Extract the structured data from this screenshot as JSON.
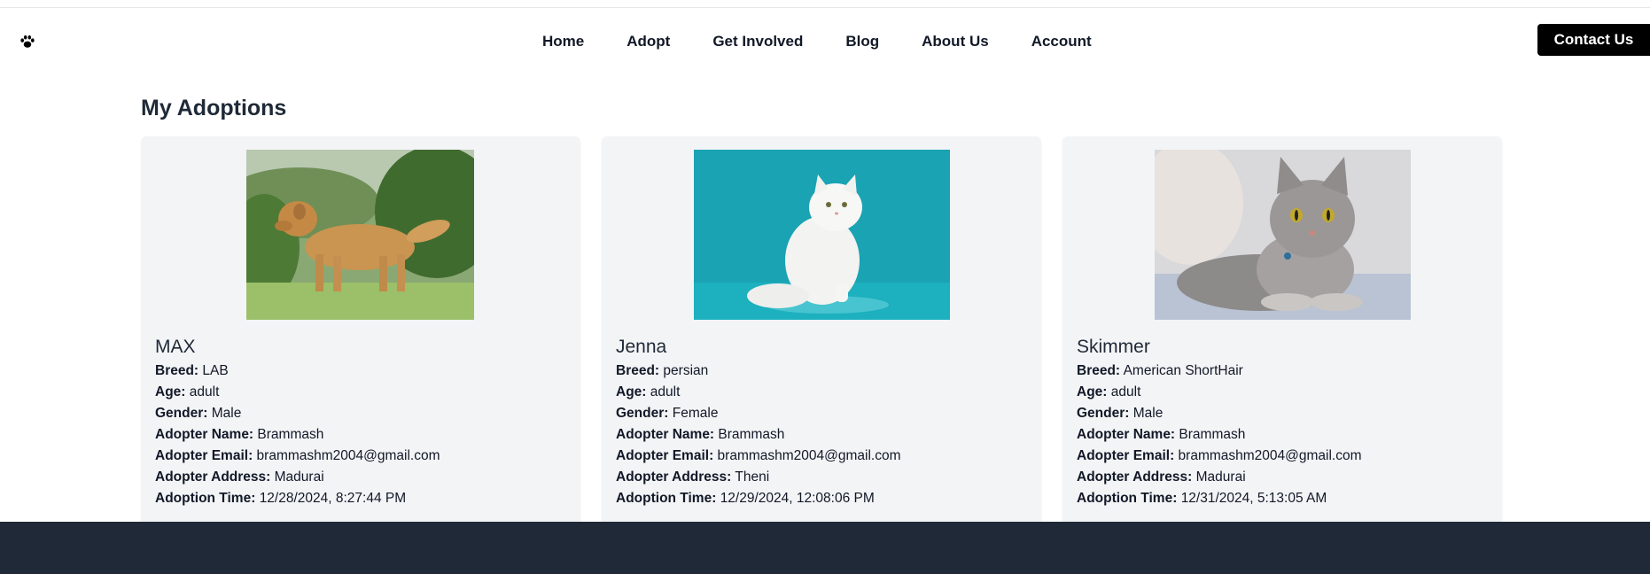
{
  "nav": {
    "logo_icon": "paw-icon",
    "links": [
      "Home",
      "Adopt",
      "Get Involved",
      "Blog",
      "About Us",
      "Account"
    ],
    "contact_label": "Contact Us"
  },
  "page": {
    "title": "My Adoptions"
  },
  "labels": {
    "breed": "Breed:",
    "age": "Age:",
    "gender": "Gender:",
    "adopter_name": "Adopter Name:",
    "adopter_email": "Adopter Email:",
    "adopter_address": "Adopter Address:",
    "adoption_time": "Adoption Time:"
  },
  "adoptions": [
    {
      "name": "MAX",
      "image": "golden-retriever-photo",
      "breed": "LAB",
      "age": "adult",
      "gender": "Male",
      "adopter_name": "Brammash",
      "adopter_email": "brammashm2004@gmail.com",
      "adopter_address": "Madurai",
      "adoption_time": "12/28/2024, 8:27:44 PM"
    },
    {
      "name": "Jenna",
      "image": "white-persian-cat-photo",
      "breed": "persian",
      "age": "adult",
      "gender": "Female",
      "adopter_name": "Brammash",
      "adopter_email": "brammashm2004@gmail.com",
      "adopter_address": "Theni",
      "adoption_time": "12/29/2024, 12:08:06 PM"
    },
    {
      "name": "Skimmer",
      "image": "tabby-shorthair-cat-photo",
      "breed": "American ShortHair",
      "age": "adult",
      "gender": "Male",
      "adopter_name": "Brammash",
      "adopter_email": "brammashm2004@gmail.com",
      "adopter_address": "Madurai",
      "adoption_time": "12/31/2024, 5:13:05 AM"
    }
  ],
  "colors": {
    "footer": "#1f2937",
    "card": "#f3f4f6",
    "contact_button": "#000000"
  }
}
